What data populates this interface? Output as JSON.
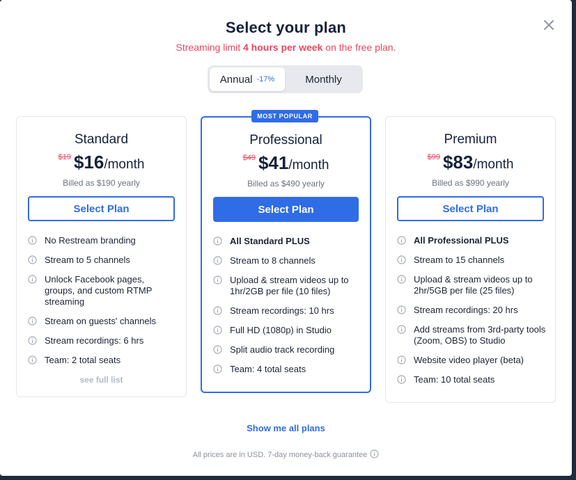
{
  "header": {
    "title": "Select your plan",
    "subtitle_prefix": "Streaming limit ",
    "subtitle_bold": "4 hours per week",
    "subtitle_suffix": " on the free plan."
  },
  "billing_toggle": {
    "annual_label": "Annual",
    "annual_discount": "-17%",
    "monthly_label": "Monthly",
    "selected": "Annual"
  },
  "badge": "MOST POPULAR",
  "plans": [
    {
      "name": "Standard",
      "old_price": "$19",
      "price": "$16",
      "per": "/month",
      "billed": "Billed as $190 yearly",
      "button": "Select Plan",
      "features": [
        "No Restream branding",
        "Stream to 5 channels",
        "Unlock Facebook pages, groups, and custom RTMP streaming",
        "Stream on guests' channels",
        "Stream recordings: 6 hrs",
        "Team: 2 total seats"
      ],
      "see_full": "see full list"
    },
    {
      "name": "Professional",
      "old_price": "$49",
      "price": "$41",
      "per": "/month",
      "billed": "Billed as $490 yearly",
      "button": "Select Plan",
      "features": [
        "All Standard PLUS",
        "Stream to 8 channels",
        "Upload & stream videos up to 1hr/2GB per file (10 files)",
        "Stream recordings: 10 hrs",
        "Full HD (1080p) in Studio",
        "Split audio track recording",
        "Team: 4 total seats"
      ]
    },
    {
      "name": "Premium",
      "old_price": "$99",
      "price": "$83",
      "per": "/month",
      "billed": "Billed as $990 yearly",
      "button": "Select Plan",
      "features": [
        "All Professional PLUS",
        "Stream to 15 channels",
        "Upload & stream videos up to 2hr/5GB per file (25 files)",
        "Stream recordings: 20 hrs",
        "Add streams from 3rd-party tools (Zoom, OBS) to Studio",
        "Website video player (beta)",
        "Team: 10 total seats"
      ]
    }
  ],
  "show_all": "Show me all plans",
  "footnote": "All prices are in USD. 7-day money-back guarantee",
  "icons": {
    "close": "close-icon",
    "info": "info-icon"
  },
  "colors": {
    "accent": "#2f6ce6",
    "warning": "#ec4561"
  }
}
